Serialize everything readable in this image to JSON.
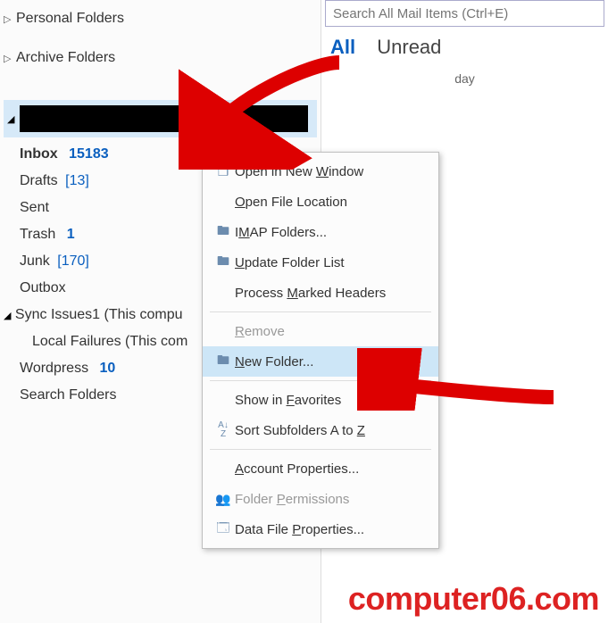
{
  "search": {
    "placeholder": "Search All Mail Items (Ctrl+E)"
  },
  "filters": {
    "all": "All",
    "unread": "Unread"
  },
  "today_label": "day",
  "sidebar": {
    "favorites_cut": "",
    "nodes": [
      {
        "label": "Personal Folders"
      },
      {
        "label": "Archive Folders"
      }
    ],
    "account": {
      "redacted": true,
      "items": [
        {
          "label": "Inbox",
          "count": "15183",
          "bold": true,
          "cnt_style": "blue"
        },
        {
          "label": "Drafts",
          "count": "[13]",
          "cnt_style": "br"
        },
        {
          "label": "Sent"
        },
        {
          "label": "Trash",
          "count": "1",
          "cnt_style": "blue"
        },
        {
          "label": "Junk",
          "count": "[170]",
          "cnt_style": "br"
        },
        {
          "label": "Outbox"
        },
        {
          "label": "Sync Issues1 (This compu",
          "expand": true
        },
        {
          "label": "Local Failures (This com",
          "sub": true
        },
        {
          "label": "Wordpress",
          "count": "10",
          "cnt_style": "blue"
        },
        {
          "label": "Search Folders"
        }
      ]
    }
  },
  "context_menu": {
    "items": [
      {
        "icon": "window-icon",
        "pre": "Open in New ",
        "ul": "W",
        "post": "indow"
      },
      {
        "icon": "",
        "pre": "",
        "ul": "O",
        "post": "pen File Location"
      },
      {
        "icon": "folder-gear-icon",
        "pre": "I",
        "ul": "M",
        "post": "AP Folders..."
      },
      {
        "icon": "folder-list-icon",
        "pre": "",
        "ul": "U",
        "post": "pdate Folder List"
      },
      {
        "icon": "",
        "pre": "Process ",
        "ul": "M",
        "post": "arked Headers"
      },
      {
        "sep": true
      },
      {
        "icon": "",
        "pre": "",
        "ul": "R",
        "post": "emove",
        "disabled": true
      },
      {
        "icon": "folder-icon",
        "pre": "",
        "ul": "N",
        "post": "ew Folder...",
        "hl": true
      },
      {
        "sep": true
      },
      {
        "icon": "",
        "pre": "Show in ",
        "ul": "F",
        "post": "avorites"
      },
      {
        "icon": "sort-az-icon",
        "pre": "Sort Subfolders A to ",
        "ul": "Z",
        "post": ""
      },
      {
        "sep": true
      },
      {
        "icon": "",
        "pre": "",
        "ul": "A",
        "post": "ccount Properties..."
      },
      {
        "icon": "people-icon",
        "pre": "Folder ",
        "ul": "P",
        "post": "ermissions",
        "disabled": true
      },
      {
        "icon": "props-icon",
        "pre": "Data File ",
        "ul": "P",
        "post": "roperties..."
      }
    ]
  },
  "watermark": "computer06.com"
}
